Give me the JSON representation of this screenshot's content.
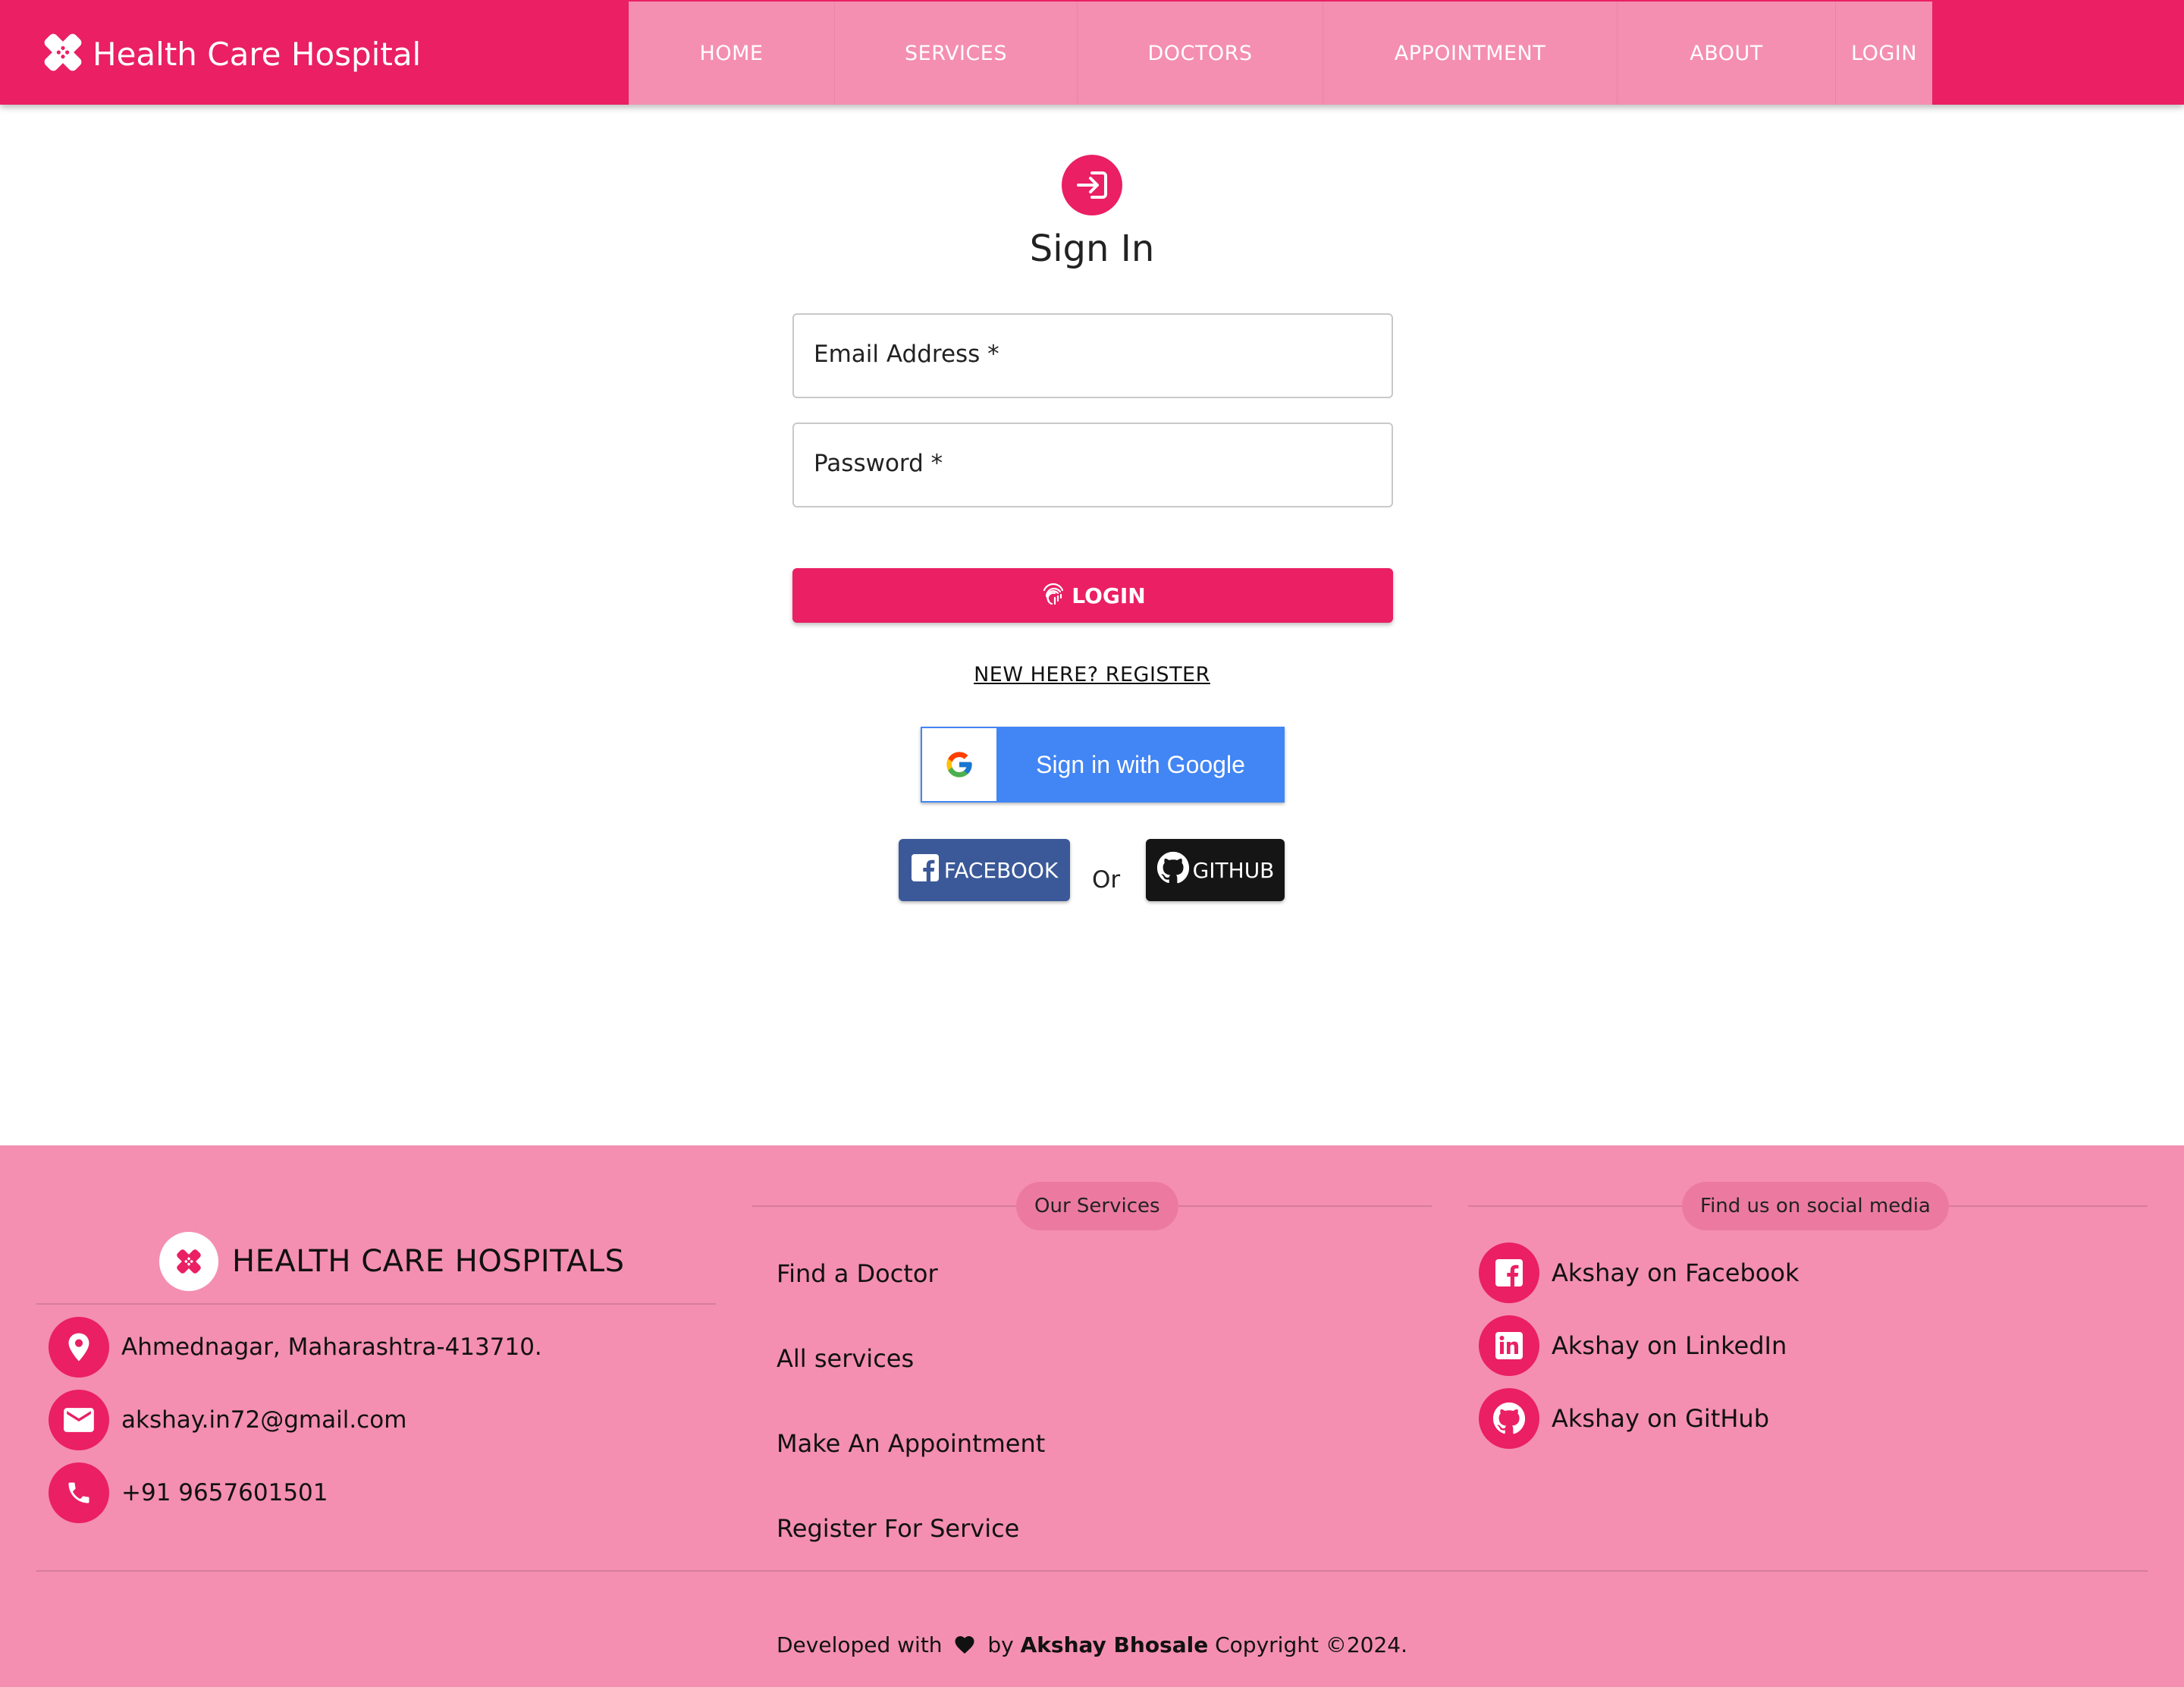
{
  "header": {
    "brand": "Health Care Hospital",
    "nav": [
      "HOME",
      "SERVICES",
      "DOCTORS",
      "APPOINTMENT",
      "ABOUT",
      "LOGIN"
    ]
  },
  "signin": {
    "title": "Sign In",
    "email_label": "Email Address *",
    "password_label": "Password *",
    "login_button": "LOGIN",
    "register_link": "NEW HERE? REGISTER",
    "google_button": "Sign in with Google",
    "facebook_button": "FACEBOOK",
    "or_text": "Or",
    "github_button": "GITHUB"
  },
  "footer": {
    "brand": "HEALTH CARE HOSPITALS",
    "address": "Ahmednagar, Maharashtra-413710.",
    "email": "akshay.in72@gmail.com",
    "phone": "+91 9657601501",
    "services_heading": "Our Services",
    "services": [
      "Find a Doctor",
      "All services",
      "Make An Appointment",
      "Register For Service"
    ],
    "social_heading": "Find us on social media",
    "social": [
      "Akshay on Facebook",
      "Akshay on LinkedIn",
      "Akshay on GitHub"
    ],
    "credit_prefix": "Developed with",
    "credit_by": "by",
    "credit_author": "Akshay Bhosale",
    "credit_suffix": "Copyright ©2024."
  },
  "colors": {
    "primary": "#ea1f64",
    "nav_background": "#f48fb1",
    "google_blue": "#4285f4",
    "facebook_blue": "#3b5998",
    "github_black": "#151515"
  },
  "icons": [
    "medical-cross-icon",
    "login-arrow-icon",
    "fingerprint-icon",
    "google-g-icon",
    "facebook-icon",
    "github-icon",
    "location-pin-icon",
    "mail-icon",
    "phone-icon",
    "linkedin-icon",
    "heart-icon"
  ]
}
